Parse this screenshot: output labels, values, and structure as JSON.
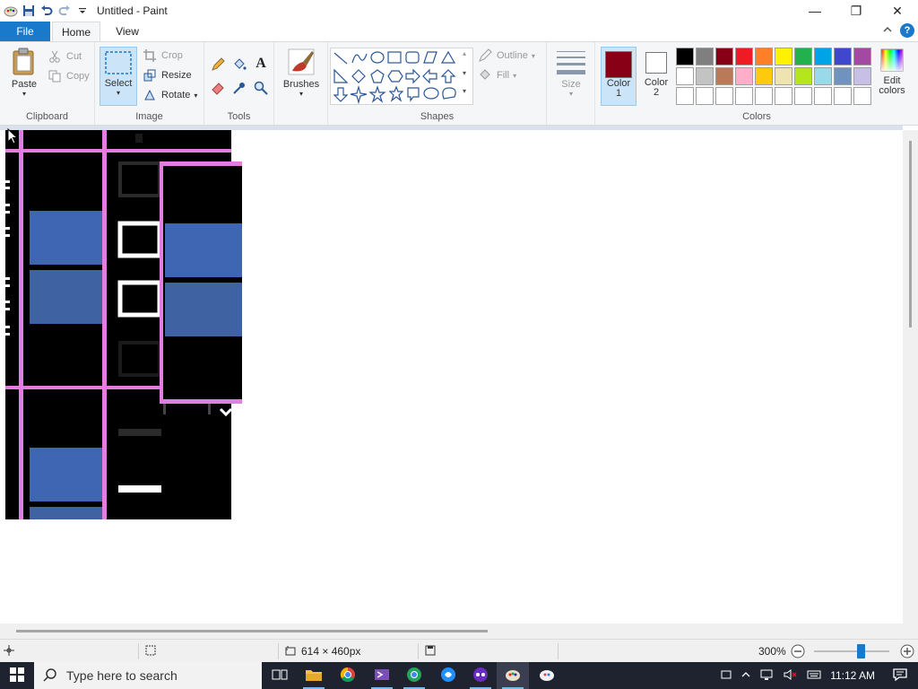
{
  "window": {
    "title": "Untitled - Paint",
    "minimize": "—",
    "maximize": "❐",
    "close": "✕"
  },
  "tabs": {
    "file": "File",
    "home": "Home",
    "view": "View"
  },
  "clipboard": {
    "label": "Clipboard",
    "paste": "Paste",
    "cut": "Cut",
    "copy": "Copy"
  },
  "image": {
    "label": "Image",
    "select": "Select",
    "crop": "Crop",
    "resize": "Resize",
    "rotate": "Rotate"
  },
  "tools": {
    "label": "Tools"
  },
  "brushes": {
    "label": "Brushes"
  },
  "shapes": {
    "label": "Shapes",
    "outline": "Outline",
    "fill": "Fill"
  },
  "size": {
    "label": "Size"
  },
  "colors": {
    "label": "Colors",
    "color1": "Color 1",
    "color1_line1": "Color",
    "color1_line2": "1",
    "color2_line1": "Color",
    "color2_line2": "2",
    "color1_value": "#880015",
    "color2_value": "#ffffff",
    "edit_line1": "Edit",
    "edit_line2": "colors",
    "palette": [
      "#000000",
      "#7f7f7f",
      "#880015",
      "#ed1c24",
      "#ff7f27",
      "#fff200",
      "#22b14c",
      "#00a2e8",
      "#3f48cc",
      "#a349a4",
      "#ffffff",
      "#c3c3c3",
      "#b97a57",
      "#ffaec9",
      "#ffc90e",
      "#efe4b0",
      "#b5e61d",
      "#99d9ea",
      "#7092be",
      "#c8bfe7",
      "#ffffff",
      "#ffffff",
      "#ffffff",
      "#ffffff",
      "#ffffff",
      "#ffffff",
      "#ffffff",
      "#ffffff",
      "#ffffff",
      "#ffffff"
    ]
  },
  "status": {
    "dimensions": "614 × 460px",
    "zoom": "300%"
  },
  "taskbar": {
    "search_placeholder": "Type here to search",
    "time": "11:12 AM"
  }
}
